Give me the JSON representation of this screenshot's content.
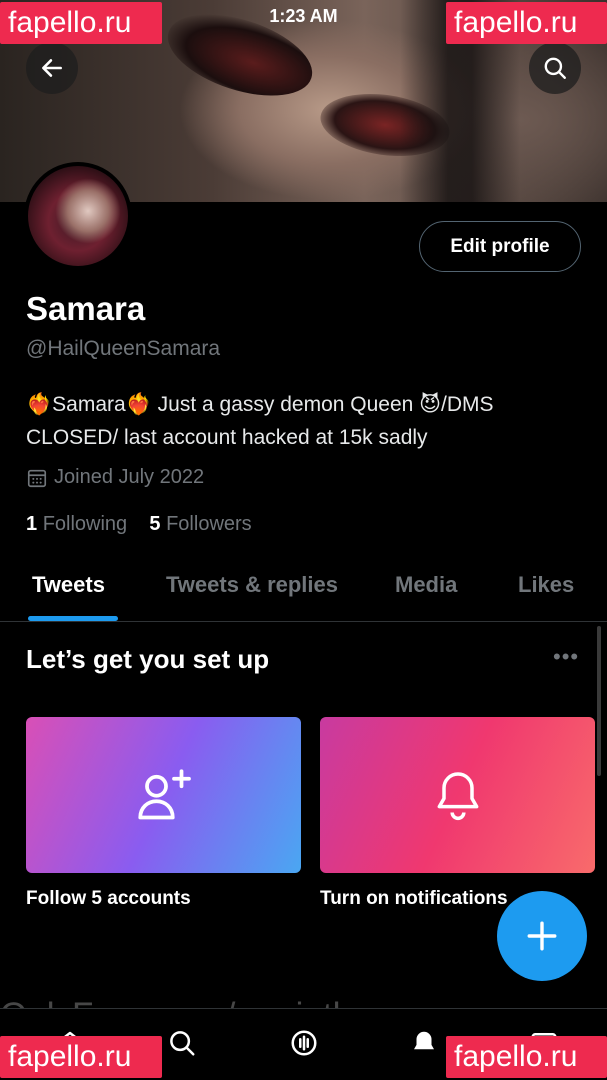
{
  "status_bar": {
    "time": "1:23 AM"
  },
  "header": {
    "back_icon": "arrow-left-icon",
    "search_icon": "search-icon"
  },
  "profile": {
    "edit_button": "Edit profile",
    "display_name": "Samara",
    "handle": "@HailQueenSamara",
    "bio_line1": "❤️‍🔥Samara❤️‍🔥 Just a gassy demon Queen 😈/DMS",
    "bio_line2": "CLOSED/ last account hacked at 15k sadly",
    "joined": "Joined July 2022",
    "following_count": "1",
    "following_label": "Following",
    "followers_count": "5",
    "followers_label": "Followers"
  },
  "tabs": [
    {
      "label": "Tweets",
      "active": true
    },
    {
      "label": "Tweets & replies",
      "active": false
    },
    {
      "label": "Media",
      "active": false
    },
    {
      "label": "Likes",
      "active": false
    }
  ],
  "setup": {
    "title": "Let’s get you set up",
    "more": "•••",
    "cards": [
      {
        "label": "Follow 5 accounts",
        "icon": "add-user-icon"
      },
      {
        "label": "Turn on notifications",
        "icon": "bell-icon"
      }
    ]
  },
  "fab": {
    "icon": "plus-icon"
  },
  "bottom_nav": [
    "home-icon",
    "search-icon",
    "spaces-icon",
    "notifications-icon",
    "messages-icon"
  ],
  "watermarks": {
    "badge": "fapello.ru",
    "overlay": "OnlyFans.com/mariethegasqueen"
  },
  "colors": {
    "accent": "#1d9bf0",
    "watermark": "#ee2a4f",
    "muted": "#71767b"
  }
}
